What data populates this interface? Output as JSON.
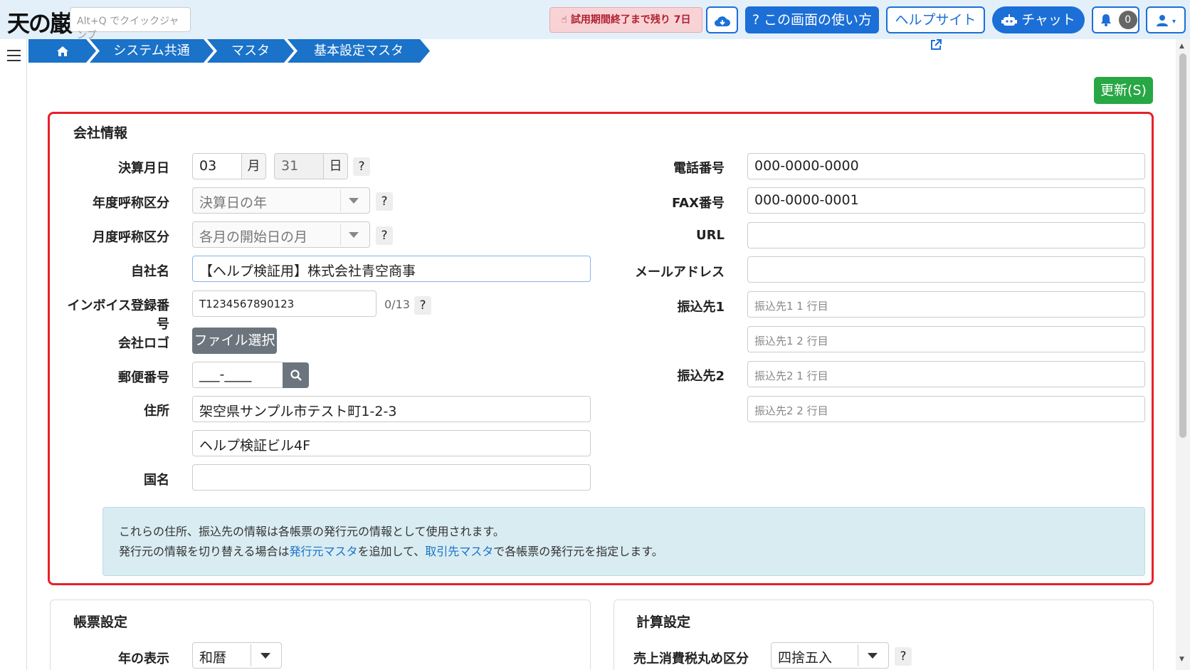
{
  "header": {
    "logo_text": "天の巌",
    "quickjump_placeholder": "Alt+Q でクイックジャンプ",
    "trial_text": "試用期間終了まで残り 7日",
    "howto_label": "? この画面の使い方",
    "helpsite_label": "ヘルプサイト",
    "chat_label": "チャット",
    "notification_count": "0"
  },
  "breadcrumb": [
    {
      "label": "⌂"
    },
    {
      "label": "システム共通"
    },
    {
      "label": "マスタ"
    },
    {
      "label": "基本設定マスタ"
    }
  ],
  "toolbar": {
    "update_label": "更新(S)"
  },
  "company": {
    "title": "会社情報",
    "fiscal_month_label": "決算月日",
    "fiscal_month_value": "03",
    "month_unit": "月",
    "fiscal_day_value": "31",
    "day_unit": "日",
    "year_naming_label": "年度呼称区分",
    "year_naming_value": "決算日の年",
    "month_naming_label": "月度呼称区分",
    "month_naming_value": "各月の開始日の月",
    "name_label": "自社名",
    "name_value": "【ヘルプ検証用】株式会社青空商事",
    "invoice_label": "インボイス登録番号",
    "invoice_value": "T1234567890123",
    "invoice_counter": "0/13",
    "logo_label": "会社ロゴ",
    "file_button": "ファイル選択",
    "postal_label": "郵便番号",
    "postal_value": "___-____",
    "address_label": "住所",
    "address1_value": "架空県サンプル市テスト町1-2-3",
    "address2_value": "ヘルプ検証ビル4F",
    "country_label": "国名",
    "country_value": "",
    "phone_label": "電話番号",
    "phone_value": "000-0000-0000",
    "fax_label": "FAX番号",
    "fax_value": "000-0000-0001",
    "url_label": "URL",
    "url_value": "",
    "email_label": "メールアドレス",
    "email_value": "",
    "bank1_label": "振込先1",
    "bank1_line1_placeholder": "振込先1 1 行目",
    "bank1_line2_placeholder": "振込先1 2 行目",
    "bank2_label": "振込先2",
    "bank2_line1_placeholder": "振込先2 1 行目",
    "bank2_line2_placeholder": "振込先2 2 行目",
    "info_line1": "これらの住所、振込先の情報は各帳票の発行元の情報として使用されます。",
    "info_line2_a": "発行元の情報を切り替える場合は",
    "info_link1": "発行元マスタ",
    "info_line2_b": "を追加して、",
    "info_link2": "取引先マスタ",
    "info_line2_c": "で各帳票の発行元を指定します。"
  },
  "form_settings": {
    "title": "帳票設定",
    "year_display_label": "年の表示",
    "year_display_value": "和暦"
  },
  "calc_settings": {
    "title": "計算設定",
    "tax_rounding_label": "売上消費税丸め区分",
    "tax_rounding_value": "四捨五入"
  },
  "help_mark": "?",
  "colors": {
    "accent": "#1c6fd6",
    "breadcrumb": "#1a72c9",
    "success": "#28a745",
    "highlight": "#e8202a"
  }
}
